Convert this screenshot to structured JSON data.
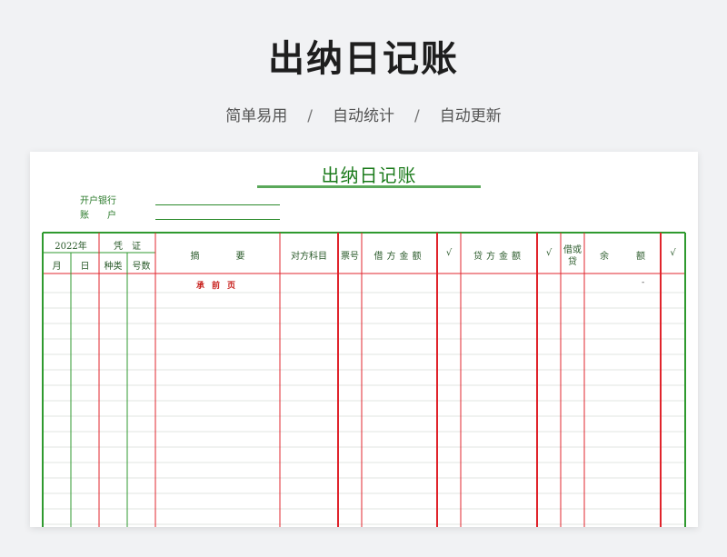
{
  "header": {
    "title": "出纳日记账",
    "subtitle": [
      "简单易用",
      "自动统计",
      "自动更新"
    ],
    "separator": "/"
  },
  "sheet": {
    "title": "出纳日记账",
    "bank_label": "开户银行",
    "account_label": "账　　户",
    "year": "2022年",
    "voucher": "凭　证",
    "month": "月",
    "day": "日",
    "voucher_type": "种类",
    "voucher_number": "号数",
    "summary": "摘　　　　要",
    "counter_account": "对方科目",
    "ticket_no": "票号",
    "debit_amount": "借方金额",
    "check_mark_1": "√",
    "credit_amount": "贷方金额",
    "check_mark_2": "√",
    "debit_or_credit_1": "借或",
    "debit_or_credit_2": "贷",
    "balance": "余　　　额",
    "check_mark_3": "√",
    "carry_forward": "承前页",
    "balance_dash": "-"
  },
  "colors": {
    "green_rule": "#2f9a2f",
    "red_rule": "#e0242c",
    "title_green": "#1a7a1a"
  }
}
